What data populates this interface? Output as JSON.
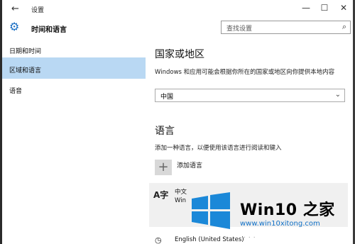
{
  "window": {
    "title": "设置",
    "back_glyph": "←",
    "min_glyph": "—",
    "max_glyph": "☐",
    "close_glyph": "✕"
  },
  "header": {
    "section_title": "时间和语言",
    "search_placeholder": "查找设置",
    "gear_icon": "⚙",
    "search_icon": "⌕"
  },
  "sidebar": {
    "items": [
      {
        "label": "日期和时间",
        "active": false
      },
      {
        "label": "区域和语言",
        "active": true
      },
      {
        "label": "语音",
        "active": false
      }
    ]
  },
  "content": {
    "region_heading": "国家或地区",
    "region_desc": "Windows 和应用可能会根据你所在的国家或地区向你提供本地内容",
    "region_value": "中国",
    "chevron": "⌄",
    "lang_heading": "语言",
    "lang_desc": "添加一种语言，以便使用该语言进行阅读和键入",
    "add_glyph": "+",
    "add_label": "添加语言",
    "languages": [
      {
        "glyph": "A字",
        "name": "中文",
        "sub": "Win"
      },
      {
        "glyph": "◷",
        "name": "English (United States)"
      }
    ]
  },
  "watermark": {
    "brand": "Win10 之家",
    "url": "www.win10xitong.com",
    "url2": "...",
    "colors": {
      "logo": "#1b88d8",
      "url": "#1170c6"
    }
  },
  "colors": {
    "accent": "#1a6fc4",
    "selection": "#b9d8f3",
    "list_bg": "#f0f0f0"
  }
}
